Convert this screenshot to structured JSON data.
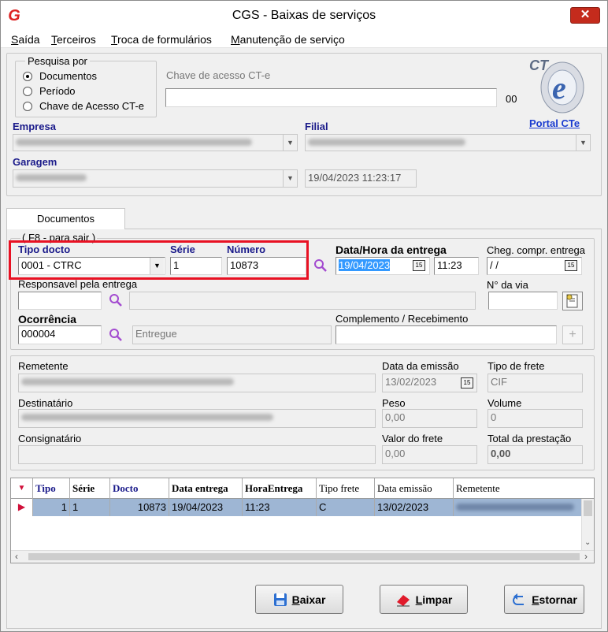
{
  "window": {
    "title": "CGS - Baixas de serviços",
    "close_glyph": "✕",
    "app_icon": "G"
  },
  "menu": [
    {
      "key": "S",
      "rest": "aída"
    },
    {
      "key": "T",
      "rest": "erceiros"
    },
    {
      "key": "T",
      "rest": "roca de formulários"
    },
    {
      "key": "M",
      "rest": "anutenção de serviço"
    }
  ],
  "search": {
    "group_label": "Pesquisa por",
    "options": [
      "Documentos",
      "Período",
      "Chave de Acesso CT-e"
    ],
    "selected": 0,
    "key_label": "Chave de acesso CT-e",
    "key_value": "",
    "key_suffix": "00",
    "portal_link": "Portal CTe",
    "logo_text": "CTe"
  },
  "empresa": {
    "label": "Empresa",
    "value": ""
  },
  "filial": {
    "label": "Filial",
    "value": ""
  },
  "garagem": {
    "label": "Garagem",
    "value": "",
    "datetime": "19/04/2023 11:23:17"
  },
  "tab": {
    "label": "Documentos",
    "group_hint": "( F8 - para sair )"
  },
  "entry": {
    "tipo_label": "Tipo docto",
    "tipo_value": "0001 - CTRC",
    "serie_label": "Série",
    "serie_value": "1",
    "numero_label": "Número",
    "numero_value": "10873",
    "data_label": "Data/Hora da entrega",
    "data_value": "19/04/2023",
    "hora_value": "11:23",
    "cheg_label": "Cheg. compr. entrega",
    "cheg_value": " /  /",
    "resp_label": "Responsavel pela entrega",
    "resp_value": "",
    "resp_name": "",
    "via_label": "N° da via",
    "via_value": "",
    "ocor_label": "Ocorrência",
    "ocor_value": "000004",
    "ocor_desc": "Entregue",
    "compl_label": "Complemento / Recebimento",
    "compl_value": "",
    "cal_glyph": "15"
  },
  "details": {
    "remetente_label": "Remetente",
    "remetente_value": "",
    "emissao_label": "Data da emissão",
    "emissao_value": "13/02/2023",
    "frete_label": "Tipo de frete",
    "frete_value": "CIF",
    "dest_label": "Destinatário",
    "dest_value": "",
    "peso_label": "Peso",
    "peso_value": "0,00",
    "volume_label": "Volume",
    "volume_value": "0",
    "consig_label": "Consignatário",
    "consig_value": "",
    "valor_label": "Valor do frete",
    "valor_value": "0,00",
    "total_label": "Total da prestação",
    "total_value": "0,00"
  },
  "grid": {
    "headers": [
      "Tipo",
      "Série",
      "Docto",
      "Data entrega",
      "HoraEntrega",
      "Tipo frete",
      "Data emissão",
      "Remetente"
    ],
    "row": [
      "1",
      "1",
      "10873",
      "19/04/2023",
      "11:23",
      "C",
      "13/02/2023",
      ""
    ]
  },
  "buttons": {
    "baixar": {
      "key": "B",
      "rest": "aixar"
    },
    "limpar": {
      "key": "L",
      "rest": "impar"
    },
    "estornar": {
      "key": "E",
      "rest": "stornar"
    }
  },
  "colors": {
    "highlight": "#e81123",
    "accent_blue": "#1a1a8a",
    "selection": "#3399ff",
    "row_bg": "#9eb6d4",
    "search_icon": "#a34bd0"
  }
}
